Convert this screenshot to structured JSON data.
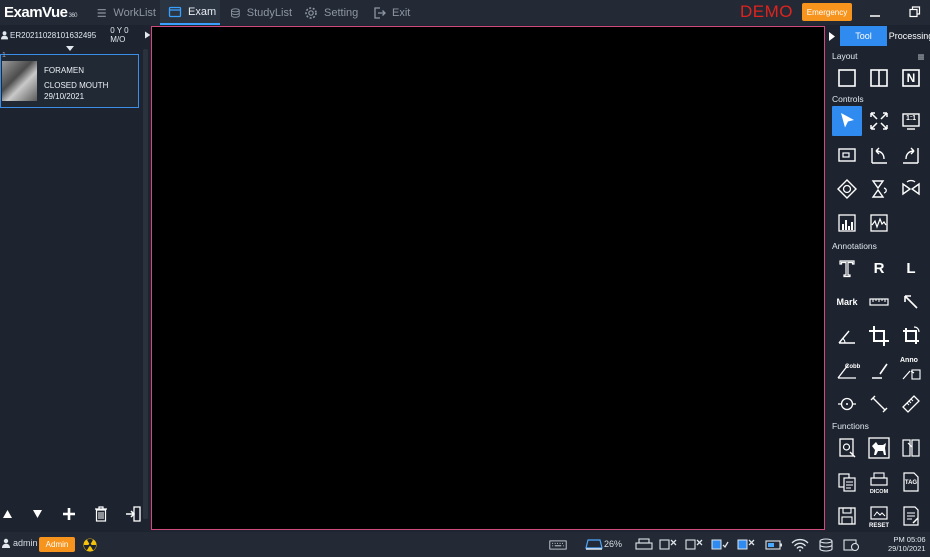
{
  "app": {
    "logo": "ExamVue",
    "logo_suffix": "360"
  },
  "nav": {
    "tabs": [
      {
        "label": "WorkList"
      },
      {
        "label": "Exam"
      },
      {
        "label": "StudyList"
      },
      {
        "label": "Setting"
      },
      {
        "label": "Exit"
      }
    ]
  },
  "header": {
    "demo": "DEMO",
    "emergency": "Emergency"
  },
  "study": {
    "id": "ER20211028101632495",
    "patient_info": "0 Y 0 M/O"
  },
  "thumbnail": {
    "index": "1",
    "title": "FORAMEN",
    "subtitle": "CLOSED MOUTH",
    "date": "29/10/2021"
  },
  "right_panel": {
    "tabs": [
      {
        "label": "Tool"
      },
      {
        "label": "Processing"
      }
    ],
    "sections": {
      "layout": "Layout",
      "controls": "Controls",
      "annotations": "Annotations",
      "functions": "Functions"
    },
    "labels": {
      "one_to_one": "1:1",
      "r": "R",
      "l": "L",
      "mark": "Mark",
      "cobb": "Cobb",
      "anno": "Anno",
      "dicom": "DICOM",
      "tag": "TAG",
      "reset": "RESET",
      "n": "N"
    }
  },
  "status": {
    "user": "admin",
    "role": "Admin",
    "battery": "26%",
    "time": "PM 05:06",
    "date": "29/10/2021"
  }
}
